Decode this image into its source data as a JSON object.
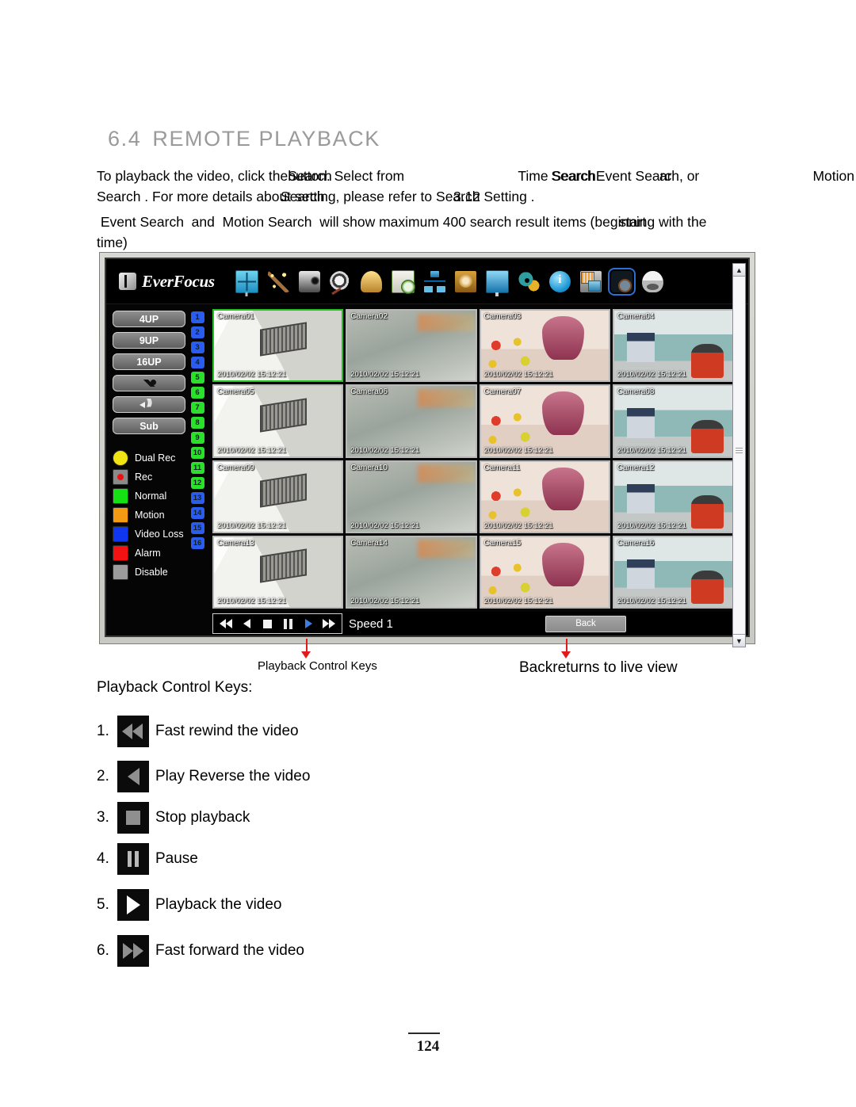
{
  "heading": {
    "number": "6.4",
    "title": "REMOTE PLAYBACK"
  },
  "paragraphs": {
    "p1_a": "To playback the video, click the",
    "p1_search_over": "Search",
    "p1_b": "button. Select from",
    "p1_time_search": "Time Search",
    "p1_time_over": "Search",
    "p1_event_search": "Event Search",
    "p1_event_over": "ar",
    "p1_c": ", or",
    "p1_motion": "Motion",
    "p1_d": "Search .  For more details about",
    "p1_about_over": "Search",
    "p1_e": "setting, please refer to",
    "p1_ref_over": "3.12",
    "p1_f": "Search Setting .",
    "p2_a": "Event Search",
    "p2_b": "and",
    "p2_c": "Motion Search",
    "p2_d": "will show maximum 400 search result items (beginning with the",
    "p2_over": "start",
    "p2_e": "time)"
  },
  "dvr": {
    "brand": "EverFocus",
    "toolbar_icons": [
      {
        "name": "display-icon",
        "class": "ic-display",
        "selected": false
      },
      {
        "name": "wizard-wand-icon",
        "class": "ic-wand",
        "selected": false
      },
      {
        "name": "camera-icon",
        "class": "ic-camera",
        "selected": false
      },
      {
        "name": "film-reel-icon",
        "class": "ic-film",
        "selected": false
      },
      {
        "name": "alarm-bell-icon",
        "class": "ic-bell",
        "selected": false
      },
      {
        "name": "schedule-clock-icon",
        "class": "ic-schedule",
        "selected": false
      },
      {
        "name": "network-icon",
        "class": "ic-network",
        "selected": false
      },
      {
        "name": "disk-icon",
        "class": "ic-disk",
        "selected": false
      },
      {
        "name": "monitor-icon",
        "class": "ic-monitor",
        "selected": false
      },
      {
        "name": "settings-gears-icon",
        "class": "ic-gears",
        "selected": false
      },
      {
        "name": "information-icon",
        "class": "ic-info",
        "selected": false
      },
      {
        "name": "backup-icon",
        "class": "ic-backup",
        "selected": false
      },
      {
        "name": "search-icon",
        "class": "ic-search",
        "selected": true
      },
      {
        "name": "dome-camera-icon",
        "class": "ic-dome",
        "selected": false
      }
    ],
    "sidebar_buttons": [
      {
        "name": "layout-4up-button",
        "label": "4UP",
        "type": "text"
      },
      {
        "name": "layout-9up-button",
        "label": "9UP",
        "type": "text"
      },
      {
        "name": "layout-16up-button",
        "label": "16UP",
        "type": "text"
      },
      {
        "name": "microphone-button",
        "label": "",
        "type": "mic"
      },
      {
        "name": "speaker-button",
        "label": "",
        "type": "speaker"
      },
      {
        "name": "sub-stream-button",
        "label": "Sub",
        "type": "text"
      }
    ],
    "legend": [
      {
        "label": "Dual Rec",
        "color": "#f2e312",
        "shape": "round"
      },
      {
        "label": "Rec",
        "color": "#ee1111",
        "shape": "box-dot"
      },
      {
        "label": "Normal",
        "color": "#14e014",
        "shape": "square"
      },
      {
        "label": "Motion",
        "color": "#f49a12",
        "shape": "square"
      },
      {
        "label": "Video Loss",
        "color": "#1036f0",
        "shape": "square"
      },
      {
        "label": "Alarm",
        "color": "#f21212",
        "shape": "square"
      },
      {
        "label": "Disable",
        "color": "#9c9c9c",
        "shape": "square"
      }
    ],
    "channels": [
      {
        "n": "1",
        "color": "#2a5cf0"
      },
      {
        "n": "2",
        "color": "#2a5cf0"
      },
      {
        "n": "3",
        "color": "#2a5cf0"
      },
      {
        "n": "4",
        "color": "#2a5cf0"
      },
      {
        "n": "5",
        "color": "#2ae02a"
      },
      {
        "n": "6",
        "color": "#2ae02a"
      },
      {
        "n": "7",
        "color": "#2ae02a"
      },
      {
        "n": "8",
        "color": "#2ae02a"
      },
      {
        "n": "9",
        "color": "#2ae02a"
      },
      {
        "n": "10",
        "color": "#2ae02a"
      },
      {
        "n": "11",
        "color": "#2ae02a"
      },
      {
        "n": "12",
        "color": "#2ae02a"
      },
      {
        "n": "13",
        "color": "#2a5cf0"
      },
      {
        "n": "14",
        "color": "#2a5cf0"
      },
      {
        "n": "15",
        "color": "#2a5cf0"
      },
      {
        "n": "16",
        "color": "#2a5cf0"
      }
    ],
    "timestamp": "2010/02/02  15:12:21",
    "cameras": [
      {
        "name": "Camera01",
        "scene": "scene-floor",
        "active": true
      },
      {
        "name": "Camera02",
        "scene": "scene-blur",
        "active": false
      },
      {
        "name": "Camera03",
        "scene": "scene-shop",
        "active": false
      },
      {
        "name": "Camera04",
        "scene": "scene-office",
        "active": false
      },
      {
        "name": "Camera05",
        "scene": "scene-floor",
        "active": false
      },
      {
        "name": "Camera06",
        "scene": "scene-blur",
        "active": false
      },
      {
        "name": "Camera07",
        "scene": "scene-shop",
        "active": false
      },
      {
        "name": "Camera08",
        "scene": "scene-office",
        "active": false
      },
      {
        "name": "Camera09",
        "scene": "scene-floor",
        "active": false
      },
      {
        "name": "Camera10",
        "scene": "scene-blur",
        "active": false
      },
      {
        "name": "Camera11",
        "scene": "scene-shop",
        "active": false
      },
      {
        "name": "Camera12",
        "scene": "scene-office",
        "active": false
      },
      {
        "name": "Camera13",
        "scene": "scene-floor",
        "active": false
      },
      {
        "name": "Camera14",
        "scene": "scene-blur",
        "active": false
      },
      {
        "name": "Camera15",
        "scene": "scene-shop",
        "active": false
      },
      {
        "name": "Camera16",
        "scene": "scene-office",
        "active": false
      }
    ],
    "playback": {
      "speed_label": "Speed 1",
      "back_label": "Back"
    }
  },
  "callouts": {
    "playback_keys": "Playback Control Keys",
    "back_a": "Back",
    "back_b": "returns to live view"
  },
  "keys_section": {
    "title": "Playback Control Keys:",
    "items": [
      {
        "num": "1.",
        "icon": "fast-rewind-icon",
        "label": "Fast rewind the video"
      },
      {
        "num": "2.",
        "icon": "play-reverse-icon",
        "label": "Play Reverse the video"
      },
      {
        "num": "3.",
        "icon": "stop-icon",
        "label": "Stop playback"
      },
      {
        "num": "4.",
        "icon": "pause-icon",
        "label": "Pause"
      },
      {
        "num": "5.",
        "icon": "play-icon",
        "label": "Playback the video"
      },
      {
        "num": "6.",
        "icon": "fast-forward-icon",
        "label": "Fast forward the video"
      }
    ]
  },
  "footer": {
    "page_number": "124"
  }
}
